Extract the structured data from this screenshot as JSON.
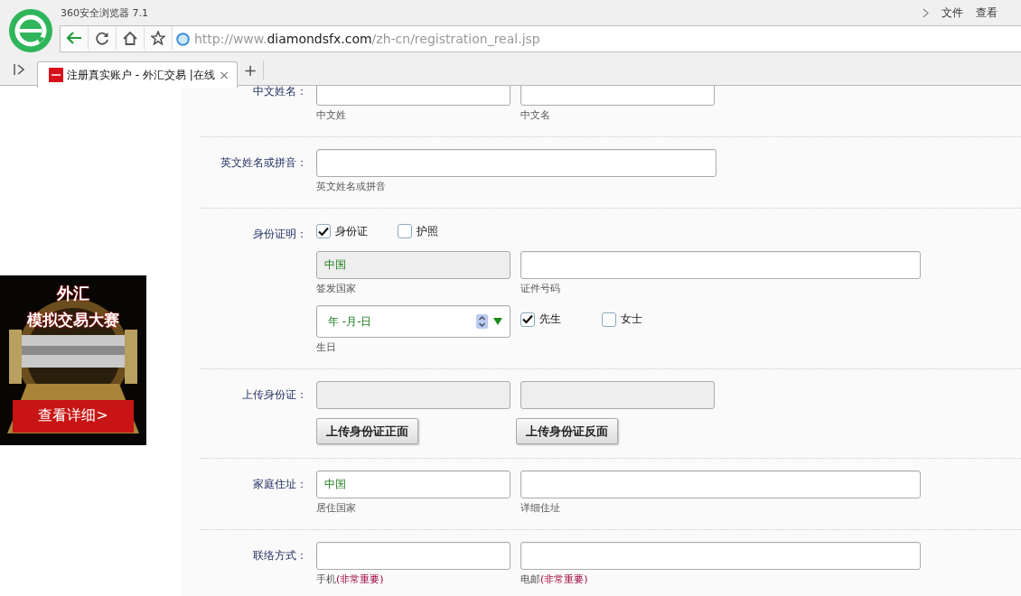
{
  "browser": {
    "app_title": "360安全浏览器 7.1",
    "menu": [
      "文件",
      "查看"
    ],
    "url": {
      "scheme": "http://www.",
      "domain": "diamondsfx.com",
      "path": "/zh-cn/registration_real.jsp"
    },
    "tabs": [
      {
        "title": "注册真实账户 - 外汇交易 |在线",
        "close": "×",
        "selected": true
      }
    ],
    "new_tab": "+"
  },
  "ad": {
    "title": "外汇",
    "subtitle": "模拟交易大赛",
    "button": "查看详细>"
  },
  "form": {
    "rows": [
      {
        "label": "中文姓名：",
        "lines": [
          [
            {
              "kind": "input",
              "wide": false,
              "hint": "中文姓"
            },
            {
              "kind": "input",
              "wide": false,
              "hint": "中文名"
            }
          ]
        ]
      },
      {
        "label": "英文姓名或拼音：",
        "lines": [
          [
            {
              "kind": "input",
              "wide": true,
              "hint": "英文姓名或拼音"
            }
          ]
        ]
      },
      {
        "label": "身份证明：",
        "lines": [
          [
            {
              "kind": "checkbox",
              "label": "身份证",
              "checked": true
            },
            {
              "kind": "checkbox",
              "label": "护照",
              "checked": false
            }
          ],
          [
            {
              "kind": "input",
              "wide": false,
              "readonly": true,
              "value": "中国",
              "hint": "签发国家"
            },
            {
              "kind": "input",
              "wide": true,
              "hint": "证件号码"
            }
          ],
          [
            {
              "kind": "date",
              "value": "年 -月-日",
              "hint": "生日"
            },
            {
              "kind": "checkbox",
              "label": "先生",
              "checked": true
            },
            {
              "kind": "checkbox",
              "label": "女士",
              "checked": false
            }
          ]
        ]
      },
      {
        "label": "上传身份证：",
        "lines": [
          [
            {
              "kind": "input",
              "wide": false,
              "readonly": true
            },
            {
              "kind": "input",
              "wide": false,
              "readonly": true
            }
          ],
          [
            {
              "kind": "button",
              "label": "上传身份证正面"
            },
            {
              "kind": "button",
              "label": "上传身份证反面"
            }
          ]
        ]
      },
      {
        "label": "家庭住址：",
        "lines": [
          [
            {
              "kind": "input",
              "wide": false,
              "value": "中国",
              "hint": "居住国家"
            },
            {
              "kind": "input",
              "wide": true,
              "hint": "详细住址"
            }
          ]
        ]
      },
      {
        "label": "联络方式：",
        "lines": [
          [
            {
              "kind": "input",
              "wide": false,
              "hint": "手机",
              "hint_note": "(非常重要)"
            },
            {
              "kind": "input",
              "wide": true,
              "hint": "电邮",
              "hint_note": "(非常重要)"
            }
          ]
        ]
      }
    ]
  }
}
